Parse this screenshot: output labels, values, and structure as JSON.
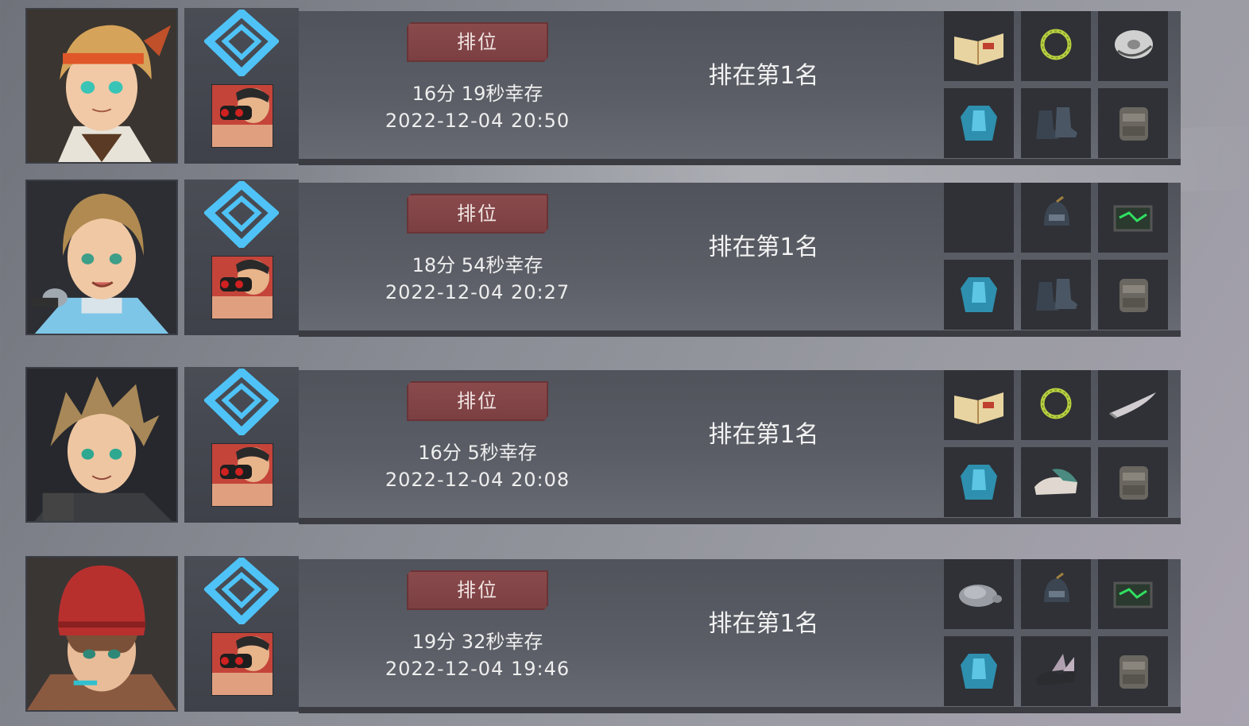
{
  "records": [
    {
      "character": "orange-headband-hero",
      "mode_label": "排位",
      "survival": "16分 19秒幸存",
      "date": "2022-12-04 20:50",
      "placement": "排在第1名",
      "items": [
        "book-icon",
        "laurel-icon",
        "disc-icon",
        "armor-icon",
        "boots-icon",
        "backpack-icon"
      ]
    },
    {
      "character": "microphone-singer",
      "mode_label": "排位",
      "survival": "18分 54秒幸存",
      "date": "2022-12-04 20:27",
      "placement": "排在第1名",
      "items": [
        "empty-slot",
        "helmet-icon",
        "chip-icon",
        "armor-icon",
        "boots-icon",
        "backpack-icon"
      ]
    },
    {
      "character": "spiky-hair-fighter",
      "mode_label": "排位",
      "survival": "16分 5秒幸存",
      "date": "2022-12-04 20:08",
      "placement": "排在第1名",
      "items": [
        "book-icon",
        "laurel-icon",
        "blade-icon",
        "armor-icon",
        "sneakers-icon",
        "backpack-icon"
      ]
    },
    {
      "character": "red-beanie-kid",
      "mode_label": "排位",
      "survival": "19分 32秒幸存",
      "date": "2022-12-04 19:46",
      "placement": "排在第1名",
      "items": [
        "turtle-icon",
        "helmet-icon",
        "chip-icon",
        "armor-icon",
        "wing-boots-icon",
        "backpack-icon"
      ]
    }
  ],
  "colors": {
    "badge": "#7b3f42",
    "rank_icon": "#4fc3f7",
    "slot_bg": "#2f3136"
  }
}
